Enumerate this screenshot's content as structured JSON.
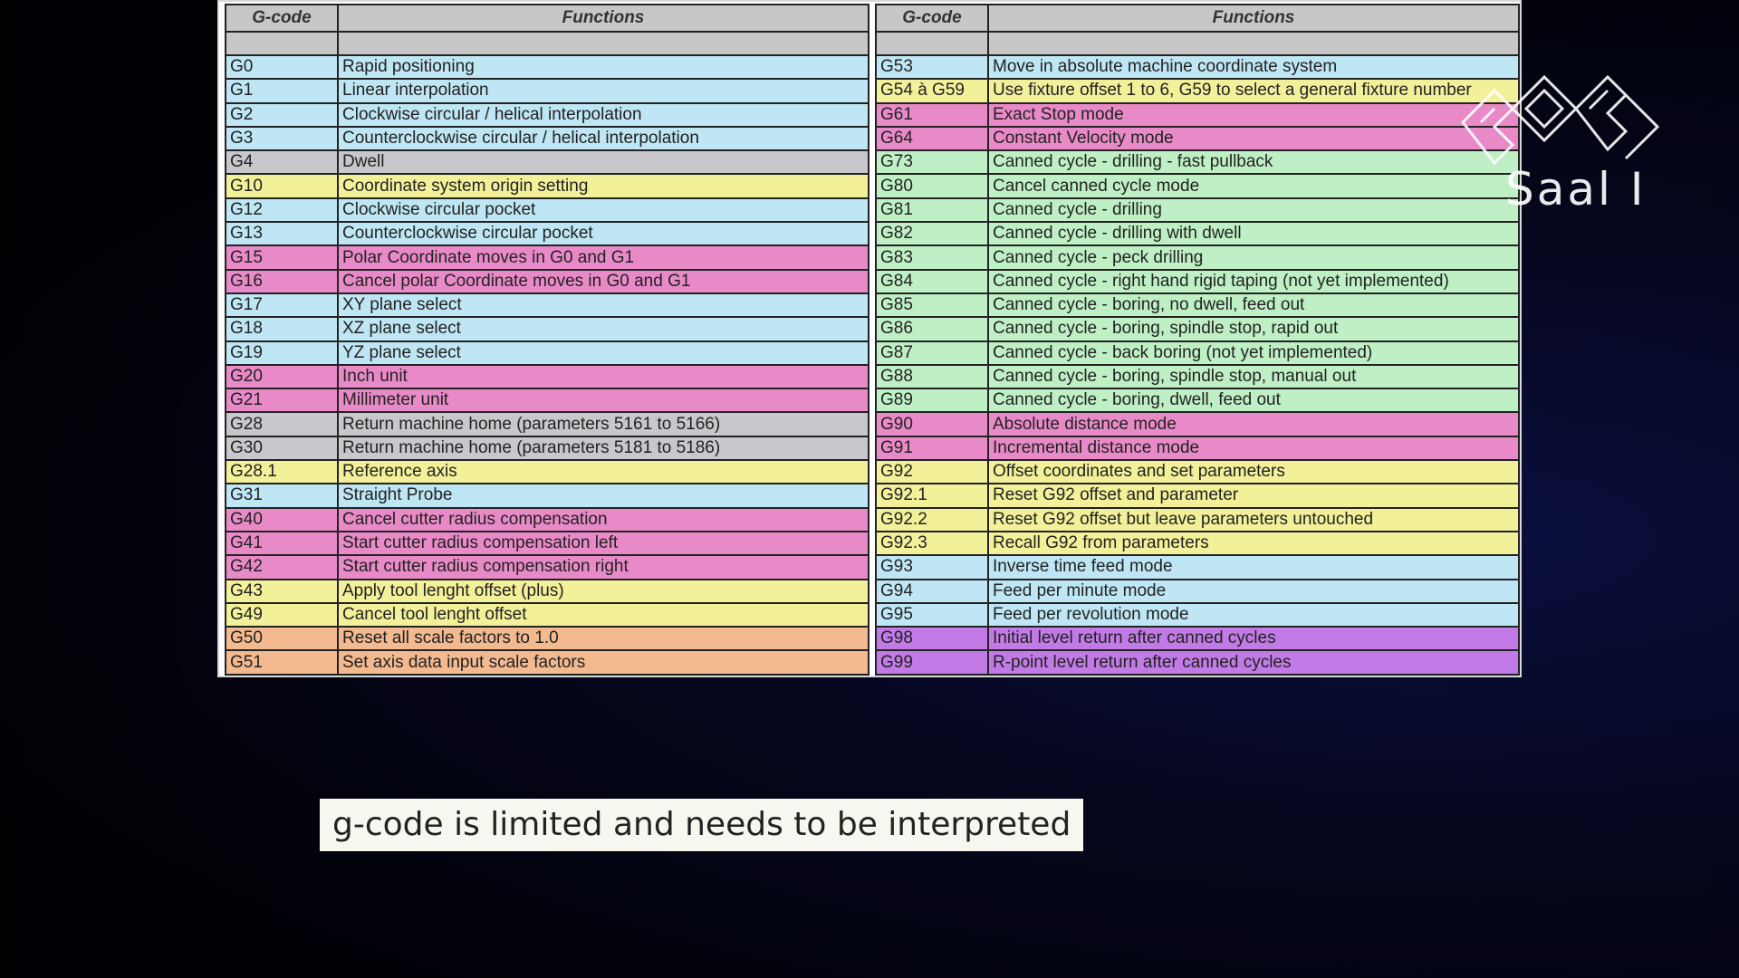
{
  "table": {
    "header_code": "G-code",
    "header_functions": "Functions",
    "left_rows": [
      {
        "code": "G0",
        "fn": "Rapid positioning",
        "color": "blue"
      },
      {
        "code": "G1",
        "fn": "Linear interpolation",
        "color": "blue"
      },
      {
        "code": "G2",
        "fn": "Clockwise circular / helical interpolation",
        "color": "blue"
      },
      {
        "code": "G3",
        "fn": "Counterclockwise circular / helical interpolation",
        "color": "blue"
      },
      {
        "code": "G4",
        "fn": "Dwell",
        "color": "gray"
      },
      {
        "code": "G10",
        "fn": "Coordinate system origin setting",
        "color": "yellow"
      },
      {
        "code": "G12",
        "fn": "Clockwise circular pocket",
        "color": "blue"
      },
      {
        "code": "G13",
        "fn": "Counterclockwise circular pocket",
        "color": "blue"
      },
      {
        "code": "G15",
        "fn": "Polar Coordinate moves in G0 and G1",
        "color": "pink"
      },
      {
        "code": "G16",
        "fn": "Cancel polar Coordinate moves in G0 and G1",
        "color": "pink"
      },
      {
        "code": "G17",
        "fn": "XY plane select",
        "color": "blue"
      },
      {
        "code": "G18",
        "fn": "XZ plane select",
        "color": "blue"
      },
      {
        "code": "G19",
        "fn": "YZ plane select",
        "color": "blue"
      },
      {
        "code": "G20",
        "fn": "Inch unit",
        "color": "pink"
      },
      {
        "code": "G21",
        "fn": "Millimeter unit",
        "color": "pink"
      },
      {
        "code": "G28",
        "fn": "Return machine home (parameters 5161 to 5166)",
        "color": "gray"
      },
      {
        "code": "G30",
        "fn": "Return machine home (parameters 5181 to 5186)",
        "color": "gray"
      },
      {
        "code": "G28.1",
        "fn": "Reference axis",
        "color": "yellow"
      },
      {
        "code": "G31",
        "fn": "Straight Probe",
        "color": "blue"
      },
      {
        "code": "G40",
        "fn": "Cancel cutter radius compensation",
        "color": "pink"
      },
      {
        "code": "G41",
        "fn": "Start cutter radius compensation left",
        "color": "pink"
      },
      {
        "code": "G42",
        "fn": "Start cutter radius compensation right",
        "color": "pink"
      },
      {
        "code": "G43",
        "fn": "Apply tool lenght offset (plus)",
        "color": "yellow"
      },
      {
        "code": "G49",
        "fn": "Cancel tool lenght offset",
        "color": "yellow"
      },
      {
        "code": "G50",
        "fn": "Reset all scale factors to 1.0",
        "color": "orange"
      },
      {
        "code": "G51",
        "fn": "Set axis data input scale factors",
        "color": "orange"
      }
    ],
    "right_rows": [
      {
        "code": "G53",
        "fn": "Move in absolute machine coordinate system",
        "color": "blue"
      },
      {
        "code": "G54 à G59",
        "fn": "Use fixture offset 1 to 6, G59 to select a general fixture number",
        "color": "yellow"
      },
      {
        "code": "G61",
        "fn": "Exact Stop mode",
        "color": "pink"
      },
      {
        "code": "G64",
        "fn": "Constant Velocity mode",
        "color": "pink"
      },
      {
        "code": "G73",
        "fn": "Canned cycle - drilling - fast pullback",
        "color": "green"
      },
      {
        "code": "G80",
        "fn": "Cancel canned cycle mode",
        "color": "green"
      },
      {
        "code": "G81",
        "fn": "Canned cycle - drilling",
        "color": "green"
      },
      {
        "code": "G82",
        "fn": "Canned cycle - drilling with dwell",
        "color": "green"
      },
      {
        "code": "G83",
        "fn": "Canned cycle - peck drilling",
        "color": "green"
      },
      {
        "code": "G84",
        "fn": "Canned cycle - right hand rigid taping (not yet implemented)",
        "color": "green"
      },
      {
        "code": "G85",
        "fn": "Canned cycle - boring, no dwell, feed out",
        "color": "green"
      },
      {
        "code": "G86",
        "fn": "Canned cycle - boring, spindle stop, rapid out",
        "color": "green"
      },
      {
        "code": "G87",
        "fn": "Canned cycle - back boring (not yet implemented)",
        "color": "green"
      },
      {
        "code": "G88",
        "fn": "Canned cycle - boring, spindle stop, manual out",
        "color": "green"
      },
      {
        "code": "G89",
        "fn": "Canned cycle - boring, dwell, feed out",
        "color": "green"
      },
      {
        "code": "G90",
        "fn": "Absolute distance mode",
        "color": "pink"
      },
      {
        "code": "G91",
        "fn": "Incremental distance mode",
        "color": "pink"
      },
      {
        "code": "G92",
        "fn": "Offset coordinates and set parameters",
        "color": "yellow"
      },
      {
        "code": "G92.1",
        "fn": "Reset G92 offset and parameter",
        "color": "yellow"
      },
      {
        "code": "G92.2",
        "fn": "Reset G92 offset but leave parameters untouched",
        "color": "yellow"
      },
      {
        "code": "G92.3",
        "fn": "Recall G92 from parameters",
        "color": "yellow"
      },
      {
        "code": "G93",
        "fn": "Inverse time feed mode",
        "color": "blue"
      },
      {
        "code": "G94",
        "fn": "Feed per minute mode",
        "color": "blue"
      },
      {
        "code": "G95",
        "fn": "Feed per revolution mode",
        "color": "blue"
      },
      {
        "code": "G98",
        "fn": "Initial level return after canned cycles",
        "color": "purple"
      },
      {
        "code": "G99",
        "fn": "R-point level return after canned cycles",
        "color": "purple"
      }
    ]
  },
  "logo": {
    "icon": "ccc-logo-icon",
    "text": "Saal I"
  },
  "subtitle": "g-code is limited and needs to be interpreted"
}
